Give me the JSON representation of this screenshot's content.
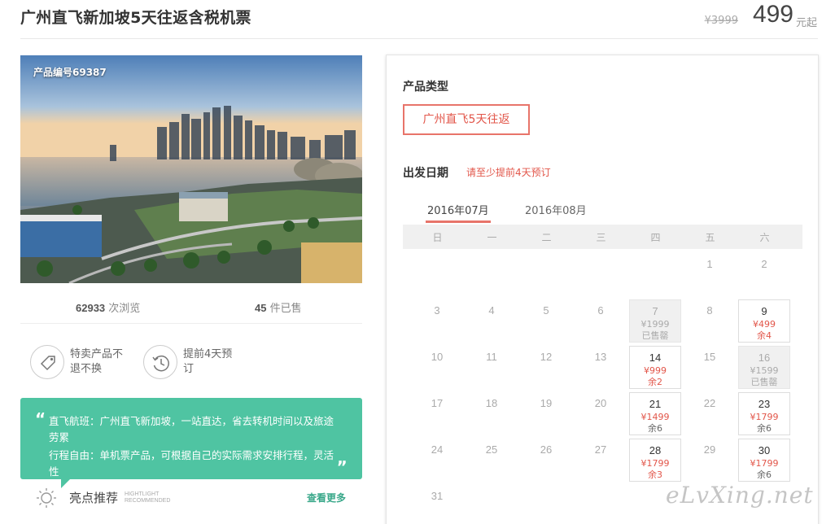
{
  "header": {
    "title": "广州直飞新加坡5天往返含税机票",
    "original_price": "¥3999",
    "price": "499",
    "price_unit": "元起"
  },
  "product": {
    "id_label": "产品编号69387",
    "views_count": "62933",
    "views_label": " 次浏览",
    "sold_count": "45",
    "sold_label": " 件已售"
  },
  "features": [
    {
      "icon": "tag-icon",
      "text": "特卖产品不退不换"
    },
    {
      "icon": "clock-icon",
      "text": "提前4天预订"
    }
  ],
  "recommend": {
    "quote_open": "“",
    "quote_close": "„",
    "line1": "直飞航班：广州直飞新加坡，一站直达，省去转机时间以及旅途劳累",
    "line2": "行程自由：单机票产品，可根据自己的实际需求安排行程，灵活性",
    "title": "亮点推荐",
    "title_en_1": "HIGHTLIGHT",
    "title_en_2": "RECOMMENDED",
    "more": "查看更多"
  },
  "booking": {
    "type_title": "产品类型",
    "type_option": "广州直飞5天往返",
    "date_title": "出发日期",
    "date_hint": "请至少提前4天预订",
    "months": [
      "2016年07月",
      "2016年08月"
    ],
    "weekdays": [
      "日",
      "一",
      "二",
      "三",
      "四",
      "五",
      "六"
    ]
  },
  "calendar": {
    "month": "2016年07月",
    "days": [
      {
        "d": "1",
        "col": 5,
        "row": 0
      },
      {
        "d": "2",
        "col": 6,
        "row": 0
      },
      {
        "d": "3",
        "col": 0,
        "row": 1
      },
      {
        "d": "4",
        "col": 1,
        "row": 1
      },
      {
        "d": "5",
        "col": 2,
        "row": 1
      },
      {
        "d": "6",
        "col": 3,
        "row": 1
      },
      {
        "d": "7",
        "col": 4,
        "row": 1,
        "state": "soldout",
        "price": "¥1999",
        "status": "已售罄"
      },
      {
        "d": "8",
        "col": 5,
        "row": 1
      },
      {
        "d": "9",
        "col": 6,
        "row": 1,
        "state": "avail",
        "price": "¥499",
        "status": "余4",
        "status_color": "red"
      },
      {
        "d": "10",
        "col": 0,
        "row": 2
      },
      {
        "d": "11",
        "col": 1,
        "row": 2
      },
      {
        "d": "12",
        "col": 2,
        "row": 2
      },
      {
        "d": "13",
        "col": 3,
        "row": 2
      },
      {
        "d": "14",
        "col": 4,
        "row": 2,
        "state": "avail",
        "price": "¥999",
        "status": "余2",
        "status_color": "red"
      },
      {
        "d": "15",
        "col": 5,
        "row": 2
      },
      {
        "d": "16",
        "col": 6,
        "row": 2,
        "state": "soldout",
        "price": "¥1599",
        "status": "已售罄"
      },
      {
        "d": "17",
        "col": 0,
        "row": 3
      },
      {
        "d": "18",
        "col": 1,
        "row": 3
      },
      {
        "d": "19",
        "col": 2,
        "row": 3
      },
      {
        "d": "20",
        "col": 3,
        "row": 3
      },
      {
        "d": "21",
        "col": 4,
        "row": 3,
        "state": "avail",
        "price": "¥1499",
        "status": "余6",
        "status_color": "gray"
      },
      {
        "d": "22",
        "col": 5,
        "row": 3
      },
      {
        "d": "23",
        "col": 6,
        "row": 3,
        "state": "avail",
        "price": "¥1799",
        "status": "余6",
        "status_color": "gray"
      },
      {
        "d": "24",
        "col": 0,
        "row": 4
      },
      {
        "d": "25",
        "col": 1,
        "row": 4
      },
      {
        "d": "26",
        "col": 2,
        "row": 4
      },
      {
        "d": "27",
        "col": 3,
        "row": 4
      },
      {
        "d": "28",
        "col": 4,
        "row": 4,
        "state": "avail",
        "price": "¥1799",
        "status": "余3",
        "status_color": "red"
      },
      {
        "d": "29",
        "col": 5,
        "row": 4
      },
      {
        "d": "30",
        "col": 6,
        "row": 4,
        "state": "avail",
        "price": "¥1799",
        "status": "余6",
        "status_color": "gray"
      },
      {
        "d": "31",
        "col": 0,
        "row": 5
      }
    ]
  },
  "watermark": "eLvXing.net"
}
